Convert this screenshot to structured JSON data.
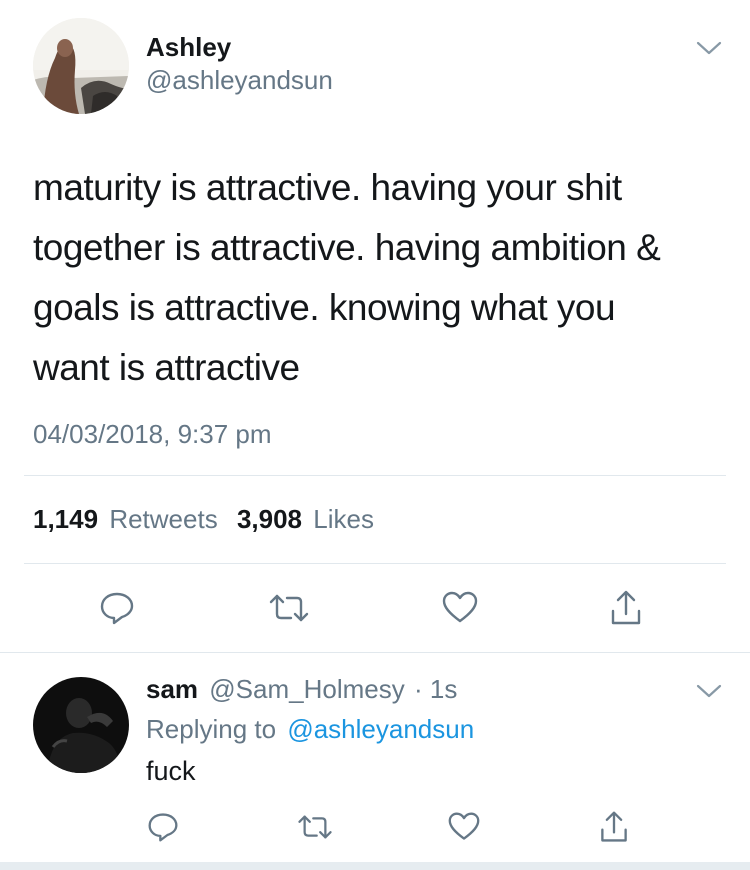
{
  "tweet": {
    "author_name": "Ashley",
    "author_handle": "@ashleyandsun",
    "text_lines": [
      "maturity is attractive. having your shit",
      "together is attractive. having ambition &",
      "goals is attractive. knowing what you",
      "want is attractive"
    ],
    "timestamp": "04/03/2018, 9:37 pm",
    "retweet_count": "1,149",
    "retweet_label": "Retweets",
    "like_count": "3,908",
    "like_label": "Likes"
  },
  "reply": {
    "author_name": "sam",
    "author_handle": "@Sam_Holmesy",
    "separator": "·",
    "time": "1s",
    "replying_label": "Replying to",
    "replying_handle": "@ashleyandsun",
    "text": "fuck"
  },
  "icons": {
    "reply": "reply-icon",
    "retweet": "retweet-icon",
    "like": "heart-icon",
    "share": "share-icon",
    "menu": "chevron-down-icon"
  },
  "colors": {
    "text": "#14171a",
    "secondary": "#657786",
    "link": "#1b95e0",
    "divider": "#e1e8ed"
  }
}
